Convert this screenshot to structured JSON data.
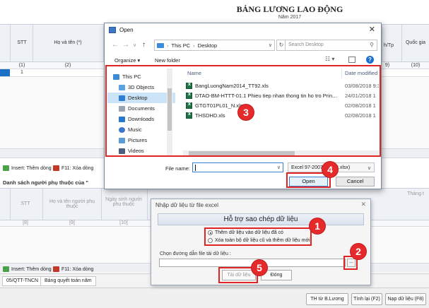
{
  "sheet": {
    "title": "BẢNG LƯƠNG LAO ĐỘNG",
    "year": "Năm 2017",
    "columns": [
      {
        "label": "STT",
        "num": "(1)"
      },
      {
        "label": "Họ và tên (*)",
        "num": "(2)"
      },
      {
        "label": "h/Tp",
        "num": "9)"
      },
      {
        "label": "Quốc gia",
        "num": "(10)"
      }
    ],
    "row_stt": "1",
    "toolbar_insert": "Insert: Thêm dòng",
    "toolbar_delete": "F11: Xóa dòng",
    "dependents_title": "Danh sách người phụ thuộc của \"",
    "dep_columns": [
      {
        "label": "STT",
        "num": "[8]"
      },
      {
        "label": "Họ và tên người phụ thuộc",
        "num": "[9]"
      },
      {
        "label": "Ngày sinh người phụ thuộc",
        "num": "[10]"
      }
    ],
    "dep_toolbar_insert": "Insert: Thêm dòng",
    "dep_toolbar_delete": "F11: Xóa dòng",
    "tabs": [
      "05/QTT-TNCN",
      "Bảng quyết toán năm"
    ],
    "bottom_buttons": {
      "th_from": "TH từ B.Lương",
      "recalc": "Tính lại (F2)",
      "import": "Nạp dữ liệu (F8)"
    },
    "right_col": "Tháng t"
  },
  "import_dialog": {
    "title": "Nhập dữ liệu từ file excel",
    "header": "Hỗ trợ sao chép dữ liệu",
    "option_add": "Thêm dữ liệu vào dữ liệu đã có",
    "option_replace": "Xóa toàn bộ dữ liệu cũ và thêm dữ liệu mới",
    "path_label": "Chọn đường dẫn file tải dữ liệu :",
    "path_value": "",
    "browse_label": "...",
    "load_button": "Tải dữ liệu",
    "close_button": "Đóng"
  },
  "open_dialog": {
    "title": "Open",
    "breadcrumb": [
      "This PC",
      "Desktop"
    ],
    "search_placeholder": "Search Desktop",
    "organize": "Organize ▾",
    "new_folder": "New folder",
    "nav_items": [
      {
        "label": "This PC",
        "icon": "computer-icon"
      },
      {
        "label": "3D Objects",
        "icon": "cube-icon"
      },
      {
        "label": "Desktop",
        "icon": "desktop-icon",
        "selected": true
      },
      {
        "label": "Documents",
        "icon": "document-icon"
      },
      {
        "label": "Downloads",
        "icon": "download-icon"
      },
      {
        "label": "Music",
        "icon": "music-icon"
      },
      {
        "label": "Pictures",
        "icon": "picture-icon"
      },
      {
        "label": "Videos",
        "icon": "video-icon"
      }
    ],
    "columns": {
      "name": "Name",
      "date": "Date modified"
    },
    "files": [
      {
        "name": "BangLuongNam2014_TT92.xls",
        "date": "03/08/2018 9:3"
      },
      {
        "name": "DTAO-BM-HTTT-01.1 Phieu tiep nhan thong tin ho tro Prin...",
        "date": "24/01/2018 1"
      },
      {
        "name": "GTGT01PL01_N.xls",
        "date": "02/08/2018 1"
      },
      {
        "name": "THSDHD.xls",
        "date": "02/08/2018 1"
      }
    ],
    "file_name_label": "File name:",
    "file_name_value": "",
    "file_type": "Excel 97-2007 (*.xls,*.xlsx)",
    "open_button": "Open",
    "cancel_button": "Cancel"
  },
  "annotations": [
    "1",
    "2",
    "3",
    "4",
    "5"
  ],
  "colors": {
    "annotation": "#e02424",
    "selection": "#1b6fc5",
    "excel": "#207245"
  }
}
